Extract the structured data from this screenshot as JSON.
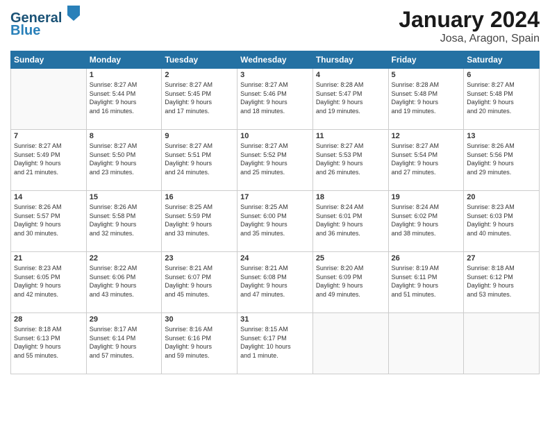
{
  "header": {
    "logo_line1": "General",
    "logo_line2": "Blue",
    "month": "January 2024",
    "location": "Josa, Aragon, Spain"
  },
  "weekdays": [
    "Sunday",
    "Monday",
    "Tuesday",
    "Wednesday",
    "Thursday",
    "Friday",
    "Saturday"
  ],
  "weeks": [
    [
      {
        "day": "",
        "lines": []
      },
      {
        "day": "1",
        "lines": [
          "Sunrise: 8:27 AM",
          "Sunset: 5:44 PM",
          "Daylight: 9 hours",
          "and 16 minutes."
        ]
      },
      {
        "day": "2",
        "lines": [
          "Sunrise: 8:27 AM",
          "Sunset: 5:45 PM",
          "Daylight: 9 hours",
          "and 17 minutes."
        ]
      },
      {
        "day": "3",
        "lines": [
          "Sunrise: 8:27 AM",
          "Sunset: 5:46 PM",
          "Daylight: 9 hours",
          "and 18 minutes."
        ]
      },
      {
        "day": "4",
        "lines": [
          "Sunrise: 8:28 AM",
          "Sunset: 5:47 PM",
          "Daylight: 9 hours",
          "and 19 minutes."
        ]
      },
      {
        "day": "5",
        "lines": [
          "Sunrise: 8:28 AM",
          "Sunset: 5:48 PM",
          "Daylight: 9 hours",
          "and 19 minutes."
        ]
      },
      {
        "day": "6",
        "lines": [
          "Sunrise: 8:27 AM",
          "Sunset: 5:48 PM",
          "Daylight: 9 hours",
          "and 20 minutes."
        ]
      }
    ],
    [
      {
        "day": "7",
        "lines": [
          "Sunrise: 8:27 AM",
          "Sunset: 5:49 PM",
          "Daylight: 9 hours",
          "and 21 minutes."
        ]
      },
      {
        "day": "8",
        "lines": [
          "Sunrise: 8:27 AM",
          "Sunset: 5:50 PM",
          "Daylight: 9 hours",
          "and 23 minutes."
        ]
      },
      {
        "day": "9",
        "lines": [
          "Sunrise: 8:27 AM",
          "Sunset: 5:51 PM",
          "Daylight: 9 hours",
          "and 24 minutes."
        ]
      },
      {
        "day": "10",
        "lines": [
          "Sunrise: 8:27 AM",
          "Sunset: 5:52 PM",
          "Daylight: 9 hours",
          "and 25 minutes."
        ]
      },
      {
        "day": "11",
        "lines": [
          "Sunrise: 8:27 AM",
          "Sunset: 5:53 PM",
          "Daylight: 9 hours",
          "and 26 minutes."
        ]
      },
      {
        "day": "12",
        "lines": [
          "Sunrise: 8:27 AM",
          "Sunset: 5:54 PM",
          "Daylight: 9 hours",
          "and 27 minutes."
        ]
      },
      {
        "day": "13",
        "lines": [
          "Sunrise: 8:26 AM",
          "Sunset: 5:56 PM",
          "Daylight: 9 hours",
          "and 29 minutes."
        ]
      }
    ],
    [
      {
        "day": "14",
        "lines": [
          "Sunrise: 8:26 AM",
          "Sunset: 5:57 PM",
          "Daylight: 9 hours",
          "and 30 minutes."
        ]
      },
      {
        "day": "15",
        "lines": [
          "Sunrise: 8:26 AM",
          "Sunset: 5:58 PM",
          "Daylight: 9 hours",
          "and 32 minutes."
        ]
      },
      {
        "day": "16",
        "lines": [
          "Sunrise: 8:25 AM",
          "Sunset: 5:59 PM",
          "Daylight: 9 hours",
          "and 33 minutes."
        ]
      },
      {
        "day": "17",
        "lines": [
          "Sunrise: 8:25 AM",
          "Sunset: 6:00 PM",
          "Daylight: 9 hours",
          "and 35 minutes."
        ]
      },
      {
        "day": "18",
        "lines": [
          "Sunrise: 8:24 AM",
          "Sunset: 6:01 PM",
          "Daylight: 9 hours",
          "and 36 minutes."
        ]
      },
      {
        "day": "19",
        "lines": [
          "Sunrise: 8:24 AM",
          "Sunset: 6:02 PM",
          "Daylight: 9 hours",
          "and 38 minutes."
        ]
      },
      {
        "day": "20",
        "lines": [
          "Sunrise: 8:23 AM",
          "Sunset: 6:03 PM",
          "Daylight: 9 hours",
          "and 40 minutes."
        ]
      }
    ],
    [
      {
        "day": "21",
        "lines": [
          "Sunrise: 8:23 AM",
          "Sunset: 6:05 PM",
          "Daylight: 9 hours",
          "and 42 minutes."
        ]
      },
      {
        "day": "22",
        "lines": [
          "Sunrise: 8:22 AM",
          "Sunset: 6:06 PM",
          "Daylight: 9 hours",
          "and 43 minutes."
        ]
      },
      {
        "day": "23",
        "lines": [
          "Sunrise: 8:21 AM",
          "Sunset: 6:07 PM",
          "Daylight: 9 hours",
          "and 45 minutes."
        ]
      },
      {
        "day": "24",
        "lines": [
          "Sunrise: 8:21 AM",
          "Sunset: 6:08 PM",
          "Daylight: 9 hours",
          "and 47 minutes."
        ]
      },
      {
        "day": "25",
        "lines": [
          "Sunrise: 8:20 AM",
          "Sunset: 6:09 PM",
          "Daylight: 9 hours",
          "and 49 minutes."
        ]
      },
      {
        "day": "26",
        "lines": [
          "Sunrise: 8:19 AM",
          "Sunset: 6:11 PM",
          "Daylight: 9 hours",
          "and 51 minutes."
        ]
      },
      {
        "day": "27",
        "lines": [
          "Sunrise: 8:18 AM",
          "Sunset: 6:12 PM",
          "Daylight: 9 hours",
          "and 53 minutes."
        ]
      }
    ],
    [
      {
        "day": "28",
        "lines": [
          "Sunrise: 8:18 AM",
          "Sunset: 6:13 PM",
          "Daylight: 9 hours",
          "and 55 minutes."
        ]
      },
      {
        "day": "29",
        "lines": [
          "Sunrise: 8:17 AM",
          "Sunset: 6:14 PM",
          "Daylight: 9 hours",
          "and 57 minutes."
        ]
      },
      {
        "day": "30",
        "lines": [
          "Sunrise: 8:16 AM",
          "Sunset: 6:16 PM",
          "Daylight: 9 hours",
          "and 59 minutes."
        ]
      },
      {
        "day": "31",
        "lines": [
          "Sunrise: 8:15 AM",
          "Sunset: 6:17 PM",
          "Daylight: 10 hours",
          "and 1 minute."
        ]
      },
      {
        "day": "",
        "lines": []
      },
      {
        "day": "",
        "lines": []
      },
      {
        "day": "",
        "lines": []
      }
    ]
  ]
}
